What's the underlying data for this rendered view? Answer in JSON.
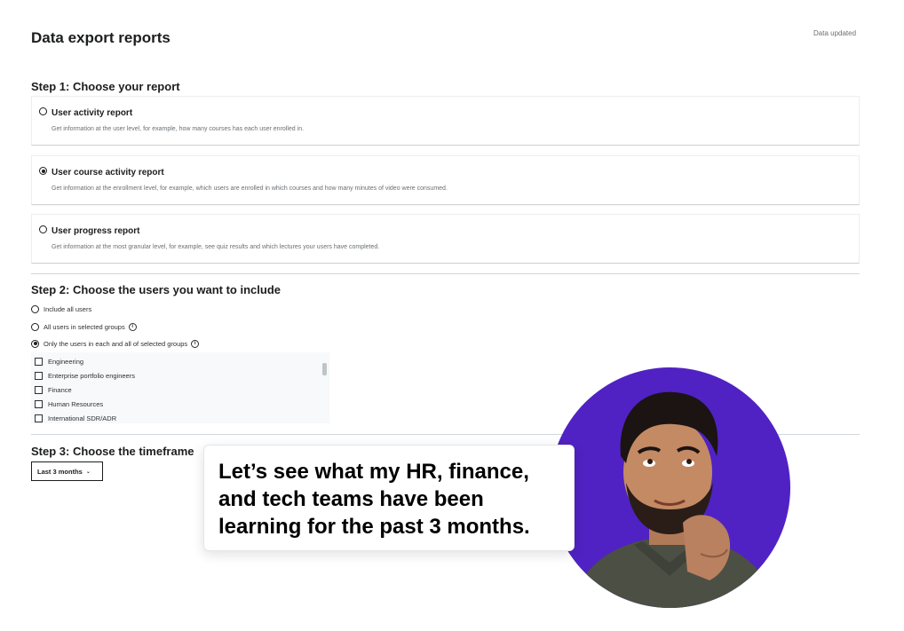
{
  "header": {
    "title": "Data export reports",
    "status": "Data updated"
  },
  "step1": {
    "title": "Step 1: Choose your report",
    "reports": [
      {
        "title": "User activity report",
        "description": "Get information at the user level, for example, how many courses has each user enrolled in.",
        "selected": false
      },
      {
        "title": "User course activity report",
        "description": "Get information at the enrollment level, for example, which users are enrolled in which courses and how many minutes of video were consumed.",
        "selected": true
      },
      {
        "title": "User progress report",
        "description": "Get information at the most granular level, for example, see quiz results and which lectures your users have completed.",
        "selected": false
      }
    ]
  },
  "step2": {
    "title": "Step 2: Choose the users you want to include",
    "options": [
      {
        "label": "Include all users",
        "selected": false
      },
      {
        "label": "All users in selected groups",
        "selected": false
      },
      {
        "label": "Only the users in each and all of selected groups",
        "selected": true
      }
    ],
    "groups": [
      "Engineering",
      "Enterprise portfolio engineers",
      "Finance",
      "Human Resources",
      "International SDR/ADR"
    ]
  },
  "step3": {
    "title": "Step 3: Choose the timeframe",
    "timeframe": "Last 3 months"
  },
  "callout": {
    "text": "Let’s see what my HR, finance, and tech teams have been learning for the past 3 months."
  },
  "colors": {
    "avatar_background": "#5022c3",
    "text_primary": "#1c1d1f",
    "text_secondary": "#6a6f73"
  }
}
